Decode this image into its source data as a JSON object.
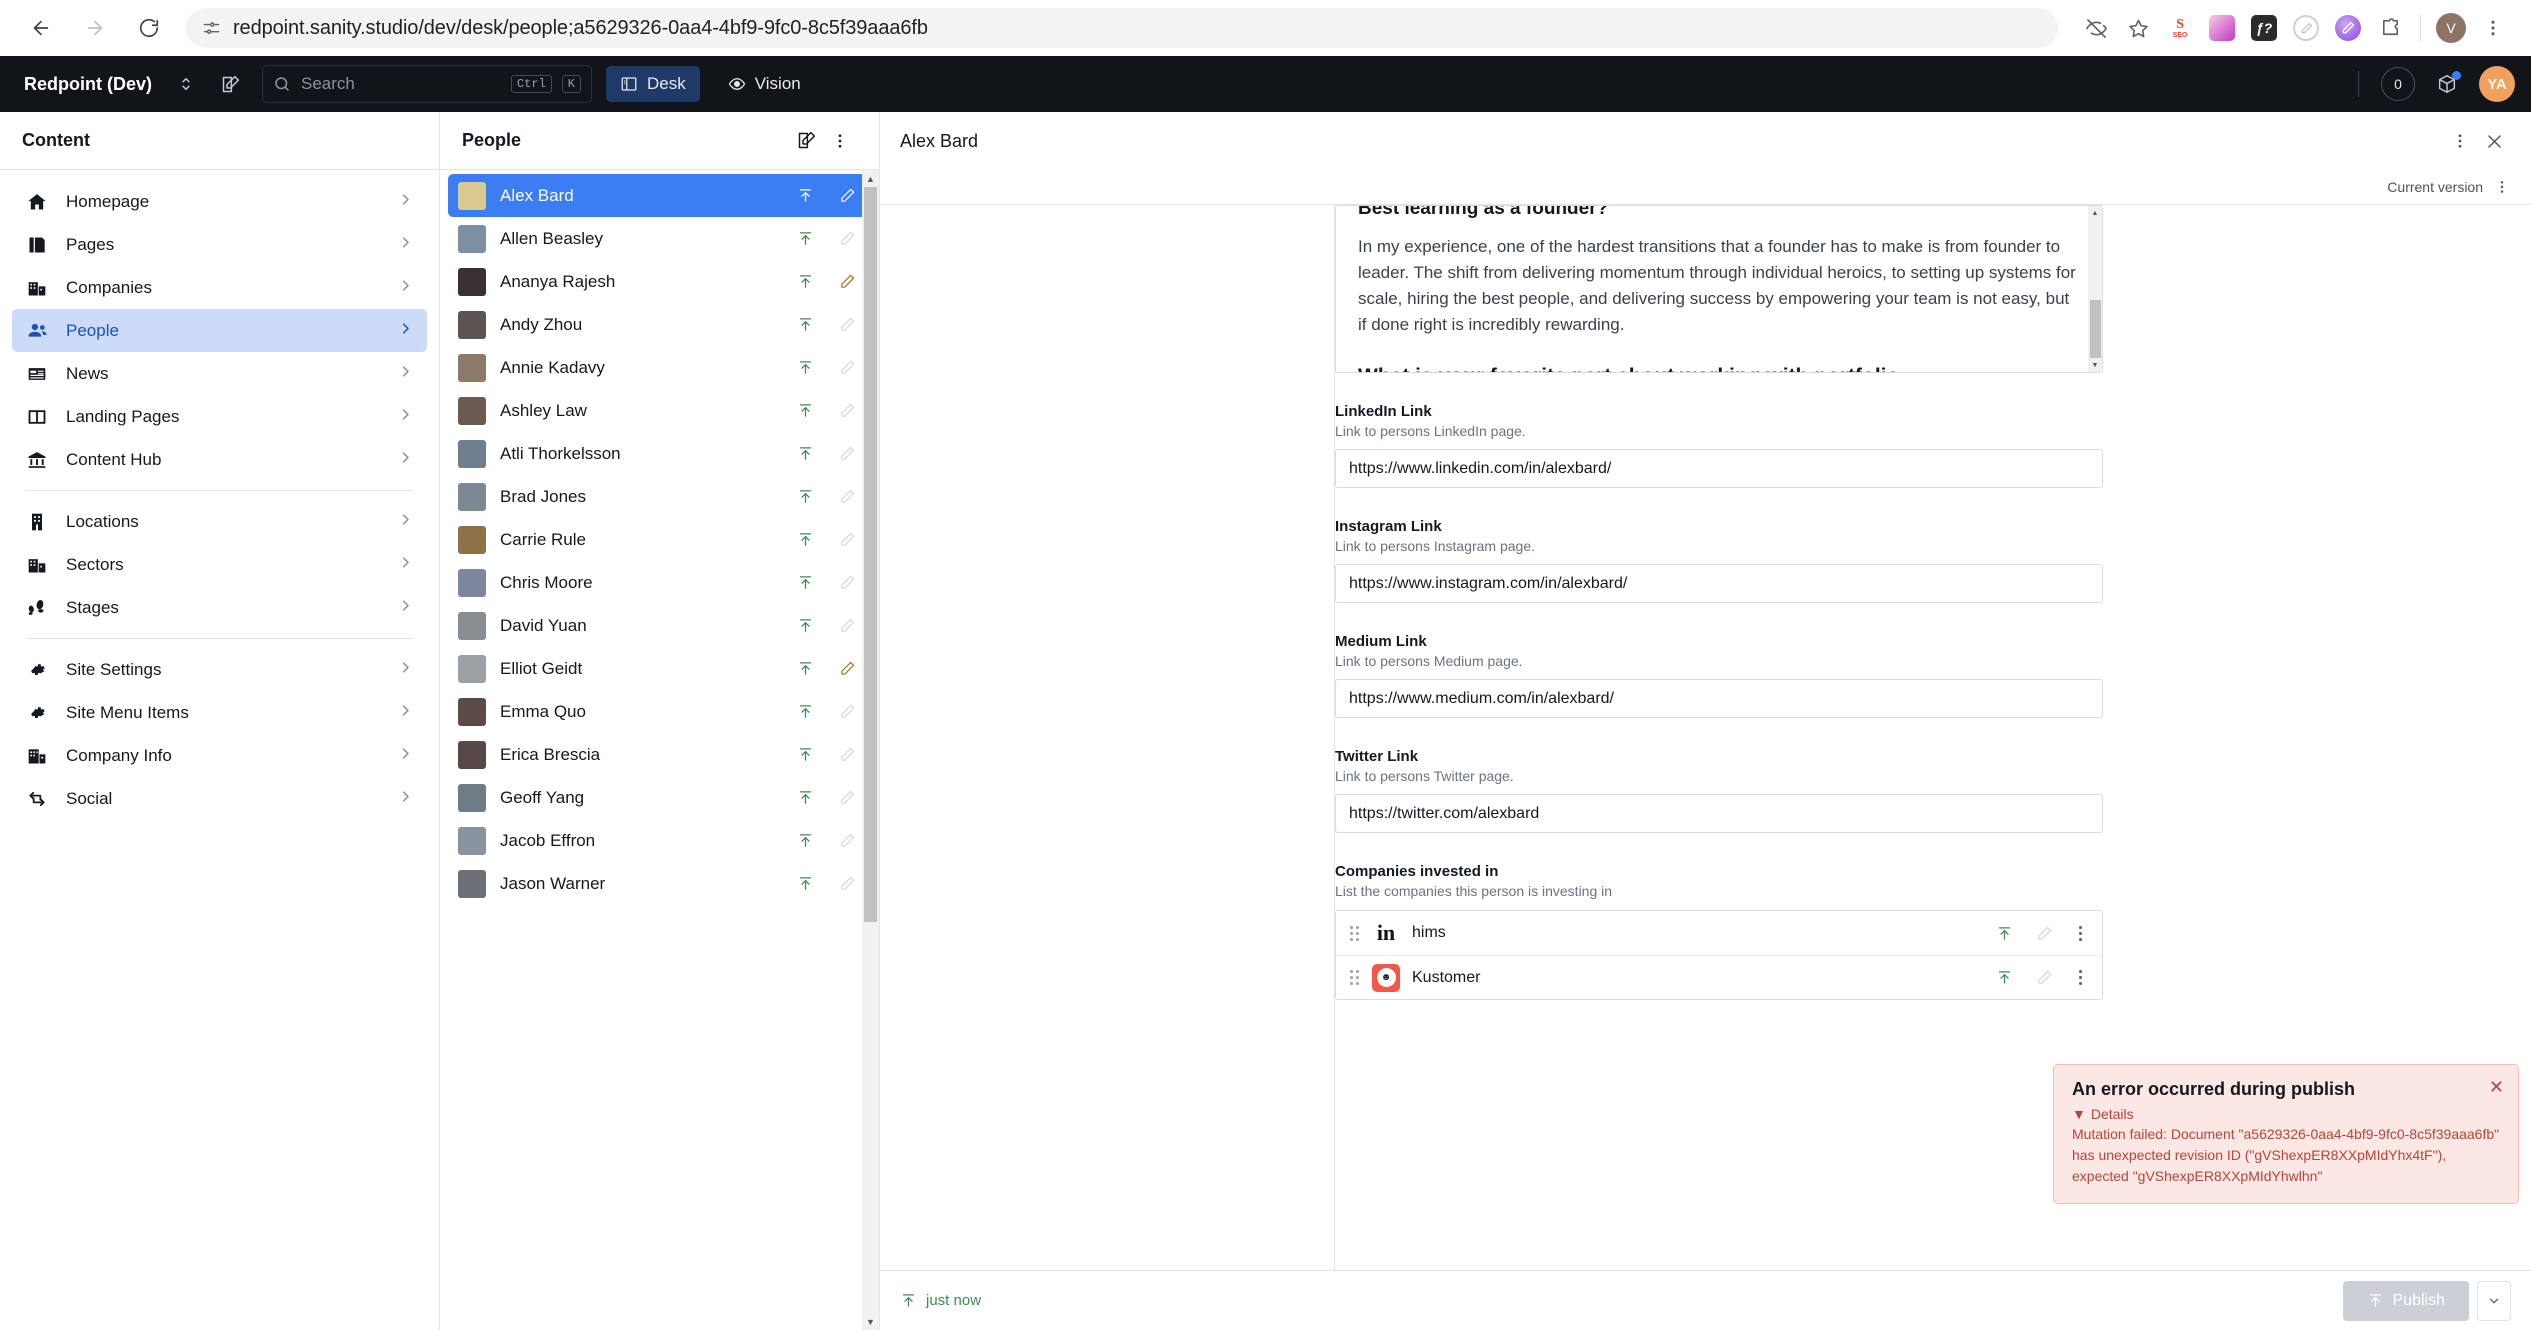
{
  "browser": {
    "url": "redpoint.sanity.studio/dev/desk/people;a5629326-0aa4-4bf9-9fc0-8c5f39aaa6fb",
    "back_label": "Back",
    "forward_label": "Forward",
    "reload_label": "Reload",
    "profile_initial": "V",
    "extensions": [
      {
        "name": "seo-extension-icon",
        "label": "SEO"
      },
      {
        "name": "gradient-extension-icon",
        "label": ""
      },
      {
        "name": "function-extension-icon",
        "label": "f?"
      },
      {
        "name": "pencil-circle-extension-icon",
        "label": ""
      },
      {
        "name": "purple-orb-extension-icon",
        "label": ""
      },
      {
        "name": "puzzle-extensions-icon",
        "label": ""
      }
    ]
  },
  "studio": {
    "workspace_title": "Redpoint (Dev)",
    "search_placeholder": "Search",
    "shortcut_mod": "Ctrl",
    "shortcut_key": "K",
    "tabs": [
      {
        "label": "Desk",
        "icon": "desk-icon",
        "active": true
      },
      {
        "label": "Vision",
        "icon": "eye-icon",
        "active": false
      }
    ],
    "notification_count": "0",
    "user_initials": "YA"
  },
  "content_pane": {
    "title": "Content",
    "items": [
      {
        "label": "Homepage",
        "icon": "home-icon",
        "active": false
      },
      {
        "label": "Pages",
        "icon": "pages-icon",
        "active": false
      },
      {
        "label": "Companies",
        "icon": "buildings-icon",
        "active": false
      },
      {
        "label": "People",
        "icon": "users-icon",
        "active": true
      },
      {
        "label": "News",
        "icon": "news-icon",
        "active": false
      },
      {
        "label": "Landing Pages",
        "icon": "layout-columns-icon",
        "active": false
      },
      {
        "label": "Content Hub",
        "icon": "bank-icon",
        "active": false
      },
      {
        "separator": true
      },
      {
        "label": "Locations",
        "icon": "office-building-icon",
        "active": false
      },
      {
        "label": "Sectors",
        "icon": "buildings-icon",
        "active": false
      },
      {
        "label": "Stages",
        "icon": "footsteps-icon",
        "active": false
      },
      {
        "separator": true
      },
      {
        "label": "Site Settings",
        "icon": "gear-icon",
        "active": false
      },
      {
        "label": "Site Menu Items",
        "icon": "gear-icon",
        "active": false
      },
      {
        "label": "Company Info",
        "icon": "company-icon",
        "active": false
      },
      {
        "label": "Social",
        "icon": "share-icon",
        "active": false
      }
    ]
  },
  "people_pane": {
    "title": "People",
    "create_label": "Create new document",
    "menu_label": "Pane menu",
    "items": [
      {
        "name": "Alex Bard",
        "selected": true,
        "published": true,
        "edited": true,
        "avatar": "#d9cb8f"
      },
      {
        "name": "Allen Beasley",
        "selected": false,
        "published": true,
        "edited": false,
        "avatar": "#7c8fa3"
      },
      {
        "name": "Ananya Rajesh",
        "selected": false,
        "published": true,
        "edited": true,
        "avatar": "#3a3034"
      },
      {
        "name": "Andy Zhou",
        "selected": false,
        "published": true,
        "edited": false,
        "avatar": "#5b5450"
      },
      {
        "name": "Annie Kadavy",
        "selected": false,
        "published": true,
        "edited": false,
        "avatar": "#8d7a66"
      },
      {
        "name": "Ashley Law",
        "selected": false,
        "published": true,
        "edited": false,
        "avatar": "#6b5a50"
      },
      {
        "name": "Atli Thorkelsson",
        "selected": false,
        "published": true,
        "edited": false,
        "avatar": "#6e7e8c"
      },
      {
        "name": "Brad Jones",
        "selected": false,
        "published": true,
        "edited": false,
        "avatar": "#7e8892"
      },
      {
        "name": "Carrie Rule",
        "selected": false,
        "published": true,
        "edited": false,
        "avatar": "#8e7147"
      },
      {
        "name": "Chris Moore",
        "selected": false,
        "published": true,
        "edited": false,
        "avatar": "#7b879a"
      },
      {
        "name": "David Yuan",
        "selected": false,
        "published": true,
        "edited": false,
        "avatar": "#8a8d90"
      },
      {
        "name": "Elliot Geidt",
        "selected": false,
        "published": true,
        "edited": true,
        "avatar": "#9ba0a4"
      },
      {
        "name": "Emma Quo",
        "selected": false,
        "published": true,
        "edited": false,
        "avatar": "#5c4a46"
      },
      {
        "name": "Erica Brescia",
        "selected": false,
        "published": true,
        "edited": false,
        "avatar": "#57484a"
      },
      {
        "name": "Geoff Yang",
        "selected": false,
        "published": true,
        "edited": false,
        "avatar": "#6f7c86"
      },
      {
        "name": "Jacob Effron",
        "selected": false,
        "published": true,
        "edited": false,
        "avatar": "#8a949e"
      },
      {
        "name": "Jason Warner",
        "selected": false,
        "published": true,
        "edited": false,
        "avatar": "#6d7076"
      }
    ]
  },
  "document": {
    "title": "Alex Bard",
    "menu_label": "Document menu",
    "close_label": "Close",
    "version_label": "Current version",
    "version_menu_label": "Version menu",
    "rich_text": {
      "heading_1": "Best learning as a founder?",
      "paragraph_1": "In my experience, one of the hardest transitions that a founder has to make is from founder to leader. The shift from delivering momentum through individual heroics, to setting up systems for scale, hiring the best people, and delivering success by empowering your team is not easy, but if done right is incredibly rewarding.",
      "heading_2": "What is your favorite part about working with portfolio companies/entrepreneurs?"
    },
    "fields": [
      {
        "label": "LinkedIn Link",
        "description": "Link to persons LinkedIn page.",
        "value": "https://www.linkedin.com/in/alexbard/"
      },
      {
        "label": "Instagram Link",
        "description": "Link to persons Instagram page.",
        "value": "https://www.instagram.com/in/alexbard/"
      },
      {
        "label": "Medium Link",
        "description": "Link to persons Medium page.",
        "value": "https://www.medium.com/in/alexbard/"
      },
      {
        "label": "Twitter Link",
        "description": "Link to persons Twitter page.",
        "value": "https://twitter.com/alexbard"
      }
    ],
    "array_field": {
      "label": "Companies invested in",
      "description": "List the companies this person is investing in",
      "items": [
        {
          "name": "hims",
          "logo": "hims-logo"
        },
        {
          "name": "Kustomer",
          "logo": "kustomer-logo"
        }
      ]
    },
    "footer": {
      "status": "just now",
      "publish_label": "Publish",
      "publish_menu_label": "Publish options"
    }
  },
  "toast": {
    "title": "An error occurred during publish",
    "details_label": "Details",
    "message": "Mutation failed: Document \"a5629326-0aa4-4bf9-9fc0-8c5f39aaa6fb\" has unexpected revision ID (\"gVShexpER8XXpMIdYhx4tF\"), expected \"gVShexpER8XXpMIdYhwlhn\"",
    "close_label": "Close"
  },
  "colors": {
    "selection_blue": "#3b7ef3",
    "nav_active_bg": "#ccdcf8",
    "nav_active_text": "#1a52b8",
    "published_green": "#3f8a53",
    "edited_amber": "#9c7a26",
    "error_bg": "#fbe7e4",
    "error_text": "#b4453a",
    "studio_bar": "#111418"
  }
}
